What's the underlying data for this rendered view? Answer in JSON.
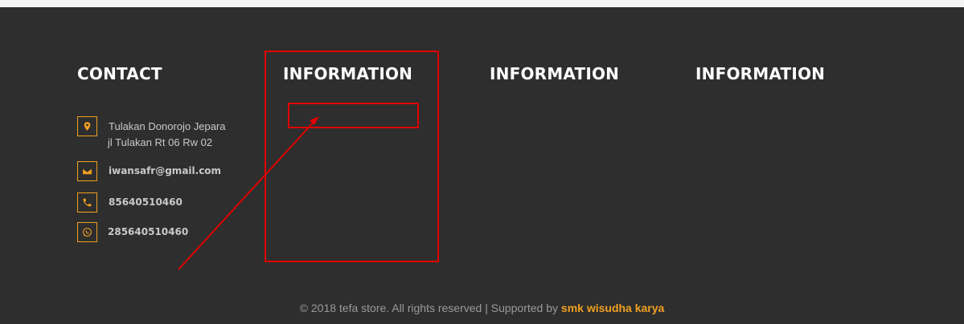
{
  "columns": {
    "contact_title": "CONTACT",
    "info_title_1": "INFORMATION",
    "info_title_2": "INFORMATION",
    "info_title_3": "INFORMATION"
  },
  "contact": {
    "address_line1": "Tulakan Donorojo Jepara",
    "address_line2": "jl Tulakan Rt 06 Rw 02",
    "email": "iwansafr@gmail.com",
    "phone": "85640510460",
    "whatsapp": "285640510460",
    "icons": [
      "location-icon",
      "mail-icon",
      "phone-icon",
      "whatsapp-icon"
    ]
  },
  "footer": {
    "copyright": "© 2018 tefa store. All rights reserved | Supported by",
    "supporter": "smk wisudha karya"
  },
  "colors": {
    "background": "#2e2e2e",
    "accent": "#f0a020",
    "annotation": "#e00000"
  }
}
